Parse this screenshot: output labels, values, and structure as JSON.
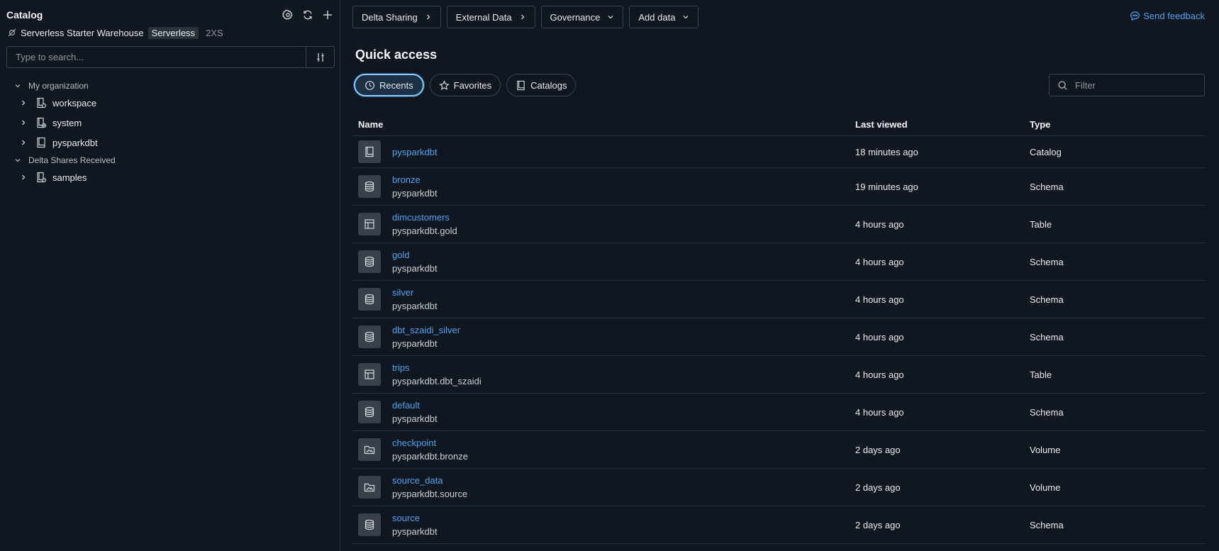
{
  "sidebar": {
    "title": "Catalog",
    "actions": [
      "gear-icon",
      "refresh-icon",
      "plus-icon"
    ],
    "warehouse": {
      "name": "Serverless Starter Warehouse",
      "badge": "Serverless",
      "size": "2XS"
    },
    "search": {
      "placeholder": "Type to search..."
    },
    "groups": [
      {
        "label": "My organization",
        "items": [
          {
            "label": "workspace",
            "icon": "catalog-workspace-icon"
          },
          {
            "label": "system",
            "icon": "catalog-system-icon"
          },
          {
            "label": "pysparkdbt",
            "icon": "catalog-icon"
          }
        ]
      },
      {
        "label": "Delta Shares Received",
        "items": [
          {
            "label": "samples",
            "icon": "shared-catalog-icon"
          }
        ]
      }
    ]
  },
  "topbar": {
    "buttons": [
      {
        "label": "Delta Sharing",
        "icon": "chevron-right-icon"
      },
      {
        "label": "External Data",
        "icon": "chevron-right-icon"
      },
      {
        "label": "Governance",
        "icon": "chevron-down-icon"
      },
      {
        "label": "Add data",
        "icon": "chevron-down-icon"
      }
    ],
    "feedback": "Send feedback"
  },
  "quick_access": {
    "title": "Quick access",
    "tabs": [
      {
        "label": "Recents",
        "icon": "clock-icon",
        "active": true
      },
      {
        "label": "Favorites",
        "icon": "star-icon",
        "active": false
      },
      {
        "label": "Catalogs",
        "icon": "catalog-icon",
        "active": false
      }
    ],
    "filter_placeholder": "Filter"
  },
  "table": {
    "headers": {
      "name": "Name",
      "viewed": "Last viewed",
      "type": "Type"
    },
    "rows": [
      {
        "name": "pysparkdbt",
        "sub": "",
        "viewed": "18 minutes ago",
        "type": "Catalog",
        "icon": "catalog"
      },
      {
        "name": "bronze",
        "sub": "pysparkdbt",
        "viewed": "19 minutes ago",
        "type": "Schema",
        "icon": "schema"
      },
      {
        "name": "dimcustomers",
        "sub": "pysparkdbt.gold",
        "viewed": "4 hours ago",
        "type": "Table",
        "icon": "table"
      },
      {
        "name": "gold",
        "sub": "pysparkdbt",
        "viewed": "4 hours ago",
        "type": "Schema",
        "icon": "schema"
      },
      {
        "name": "silver",
        "sub": "pysparkdbt",
        "viewed": "4 hours ago",
        "type": "Schema",
        "icon": "schema"
      },
      {
        "name": "dbt_szaidi_silver",
        "sub": "pysparkdbt",
        "viewed": "4 hours ago",
        "type": "Schema",
        "icon": "schema"
      },
      {
        "name": "trips",
        "sub": "pysparkdbt.dbt_szaidi",
        "viewed": "4 hours ago",
        "type": "Table",
        "icon": "table"
      },
      {
        "name": "default",
        "sub": "pysparkdbt",
        "viewed": "4 hours ago",
        "type": "Schema",
        "icon": "schema"
      },
      {
        "name": "checkpoint",
        "sub": "pysparkdbt.bronze",
        "viewed": "2 days ago",
        "type": "Volume",
        "icon": "volume"
      },
      {
        "name": "source_data",
        "sub": "pysparkdbt.source",
        "viewed": "2 days ago",
        "type": "Volume",
        "icon": "volume"
      },
      {
        "name": "source",
        "sub": "pysparkdbt",
        "viewed": "2 days ago",
        "type": "Schema",
        "icon": "schema"
      }
    ]
  }
}
